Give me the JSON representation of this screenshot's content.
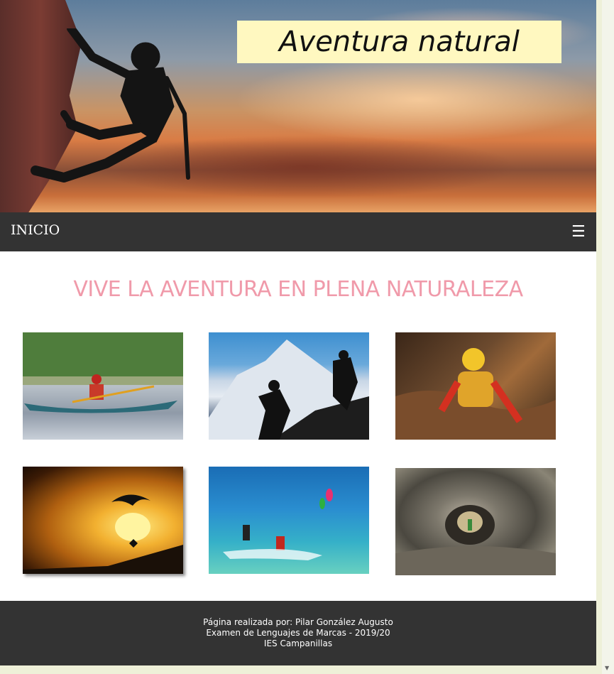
{
  "header": {
    "title": "Aventura natural"
  },
  "nav": {
    "home_label": "INICIO",
    "menu_icon": "☰"
  },
  "main": {
    "heading": "VIVE LA AVENTURA EN PLENA NATURALEZA",
    "heading_color": "#f09aaa",
    "photos": [
      {
        "icon": "kayak-photo"
      },
      {
        "icon": "mountain-hikers-photo"
      },
      {
        "icon": "caving-photo"
      },
      {
        "icon": "paragliding-sunset-photo"
      },
      {
        "icon": "kitesurf-photo"
      },
      {
        "icon": "cave-tunnel-photo"
      }
    ]
  },
  "footer": {
    "line1": "Página realizada por: Pilar González Augusto",
    "line2": "Examen de Lenguajes de Marcas - 2019/20",
    "line3": "IES Campanillas",
    "background": "#333333"
  }
}
